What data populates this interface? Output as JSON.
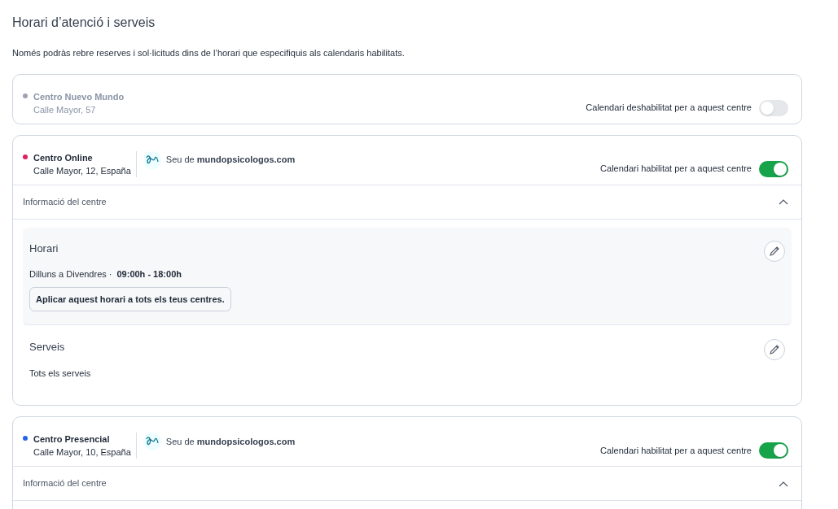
{
  "title": "Horari d’atenció i serveis",
  "intro": "Només podràs rebre reserves i sol·licituds dins de l’horari que especifiquis als calendaris habilitats.",
  "centers": [
    {
      "name": "Centro Nuevo Mundo",
      "address": "Calle Mayor, 57",
      "color": "#9ca3af",
      "enabled": false,
      "toggle_label": "Calendari deshabilitat per a aquest centre"
    },
    {
      "name": "Centro Online",
      "address": "Calle Mayor, 12, España",
      "color": "#e11d63",
      "enabled": true,
      "seu": "Seu de **mundopsicologos.com**",
      "toggle_label": "Calendari habilitat per a aquest centre",
      "info": {
        "label": "Informació del centre",
        "expanded": true,
        "sections": [
          {
            "kind": "schedule",
            "title": "Horari",
            "days": "Dilluns a Divendres ·",
            "hours": "09:00h - 18:00h",
            "button": "Aplicar aquest horari a tots els teus centres."
          },
          {
            "kind": "services",
            "title": "Serveis",
            "text": "Tots els serveis"
          }
        ]
      }
    },
    {
      "name": "Centro Presencial",
      "address": "Calle Mayor, 10, España",
      "color": "#2563eb",
      "enabled": true,
      "seu": "Seu de **mundopsicologos.com**",
      "toggle_label": "Calendari habilitat per a aquest centre",
      "info": {
        "label": "Informació del centre",
        "expanded": true
      }
    }
  ]
}
